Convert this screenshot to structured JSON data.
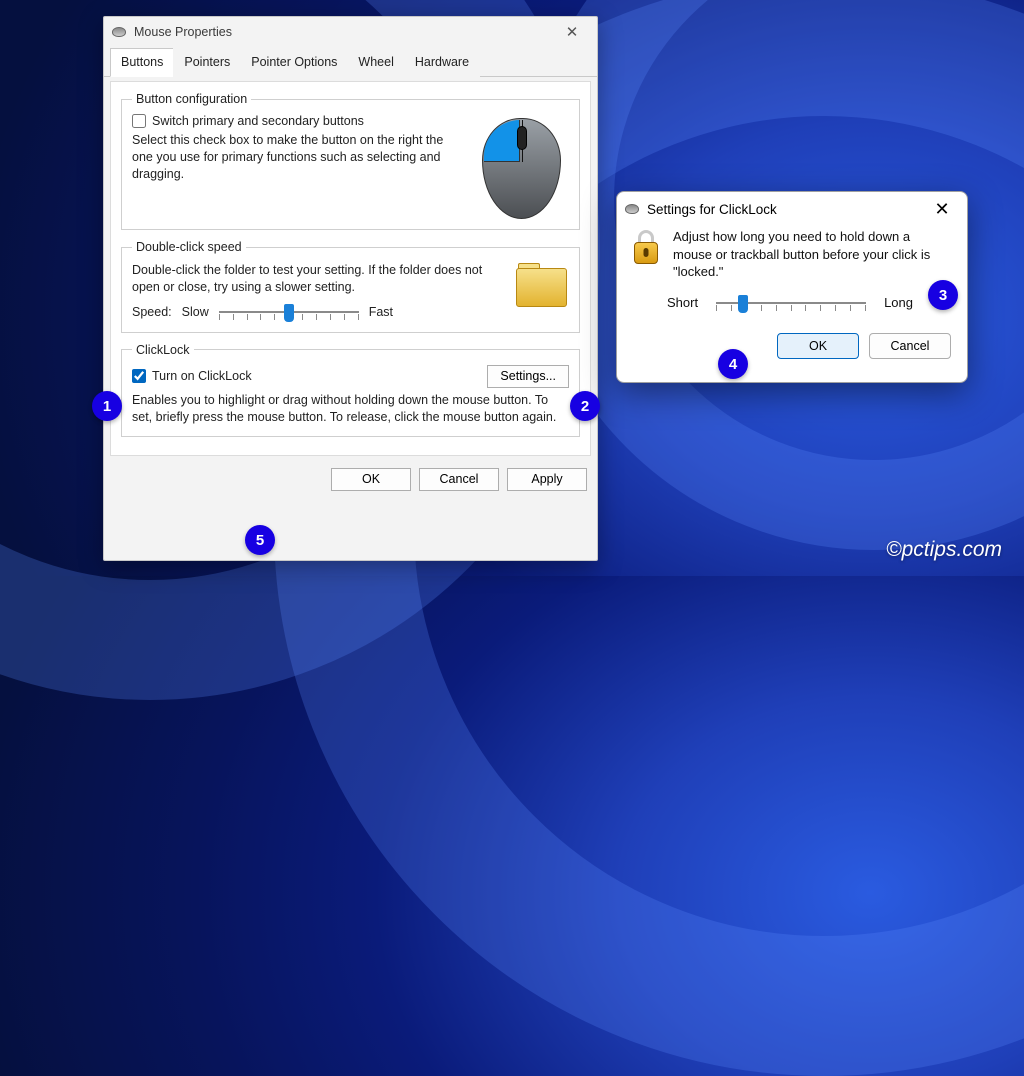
{
  "wallpaper_watermark": "©pctips.com",
  "markers": {
    "1": "1",
    "2": "2",
    "3": "3",
    "4": "4",
    "5": "5"
  },
  "main": {
    "title": "Mouse Properties",
    "tabs": [
      "Buttons",
      "Pointers",
      "Pointer Options",
      "Wheel",
      "Hardware"
    ],
    "active_tab": 0,
    "group_button_config": {
      "legend": "Button configuration",
      "checkbox_label": "Switch primary and secondary buttons",
      "checked": false,
      "desc": "Select this check box to make the button on the right the one you use for primary functions such as selecting and dragging."
    },
    "group_dblclick": {
      "legend": "Double-click speed",
      "desc": "Double-click the folder to test your setting. If the folder does not open or close, try using a slower setting.",
      "speed_label": "Speed:",
      "slow_label": "Slow",
      "fast_label": "Fast",
      "slider_value_pct": 50
    },
    "group_clicklock": {
      "legend": "ClickLock",
      "checkbox_label": "Turn on ClickLock",
      "checked": true,
      "settings_btn": "Settings...",
      "desc": "Enables you to highlight or drag without holding down the mouse button. To set, briefly press the mouse button. To release, click the mouse button again."
    },
    "buttons": {
      "ok": "OK",
      "cancel": "Cancel",
      "apply": "Apply"
    }
  },
  "sub": {
    "title": "Settings for ClickLock",
    "desc": "Adjust how long you need to hold down a mouse or trackball button before your click is \"locked.\"",
    "short_label": "Short",
    "long_label": "Long",
    "slider_value_pct": 18,
    "ok": "OK",
    "cancel": "Cancel"
  }
}
